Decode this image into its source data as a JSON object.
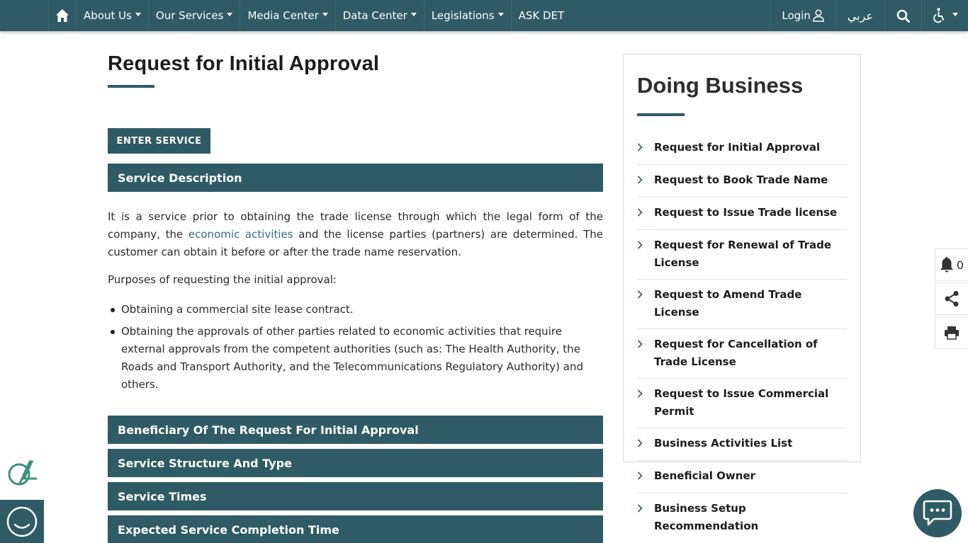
{
  "nav": {
    "items": [
      {
        "label": "About Us"
      },
      {
        "label": "Our Services"
      },
      {
        "label": "Media Center"
      },
      {
        "label": "Data Center"
      },
      {
        "label": "Legislations"
      },
      {
        "label": "ASK DET"
      }
    ],
    "login_label": "Login",
    "lang_label": "عربي",
    "icons": [
      "home-icon",
      "user-icon",
      "search-icon",
      "accessibility-icon"
    ]
  },
  "main": {
    "title": "Request for Initial Approval",
    "enter_button": "ENTER SERVICE",
    "sections": [
      "Service Description",
      "Beneficiary Of The Request For Initial Approval",
      "Service Structure And Type",
      "Service Times",
      "Expected Service Completion Time"
    ],
    "description": {
      "intro_before_link": "It is a service prior to obtaining the trade license through which the legal form of the company, the ",
      "link_text": "economic activities",
      "intro_after_link": " and the license parties (partners) are determined. The customer can obtain it before or after the trade name reservation.",
      "purposes_heading": "Purposes of requesting the initial approval:",
      "purposes": [
        "Obtaining a commercial site lease contract.",
        "Obtaining the approvals of other parties related to economic activities that require external approvals from the competent authorities (such as: The Health Authority, the Roads and Transport Authority, and the Telecommunications Regulatory Authority) and others."
      ]
    }
  },
  "sidebar": {
    "title": "Doing Business",
    "items": [
      "Request for Initial Approval",
      "Request to Book Trade Name",
      "Request to Issue Trade license",
      "Request for Renewal of Trade License",
      "Request to Amend Trade License",
      "Request for Cancellation of Trade License",
      "Request to Issue Commercial Permit",
      "Business Activities List",
      "Beneficial Owner",
      "Business Setup Recommendation"
    ]
  },
  "tools": {
    "notification_count": "0",
    "icons": [
      "bell-icon",
      "share-icon",
      "print-icon"
    ]
  },
  "colors": {
    "primary": "#2e5b66",
    "link": "#2e6f7d"
  }
}
